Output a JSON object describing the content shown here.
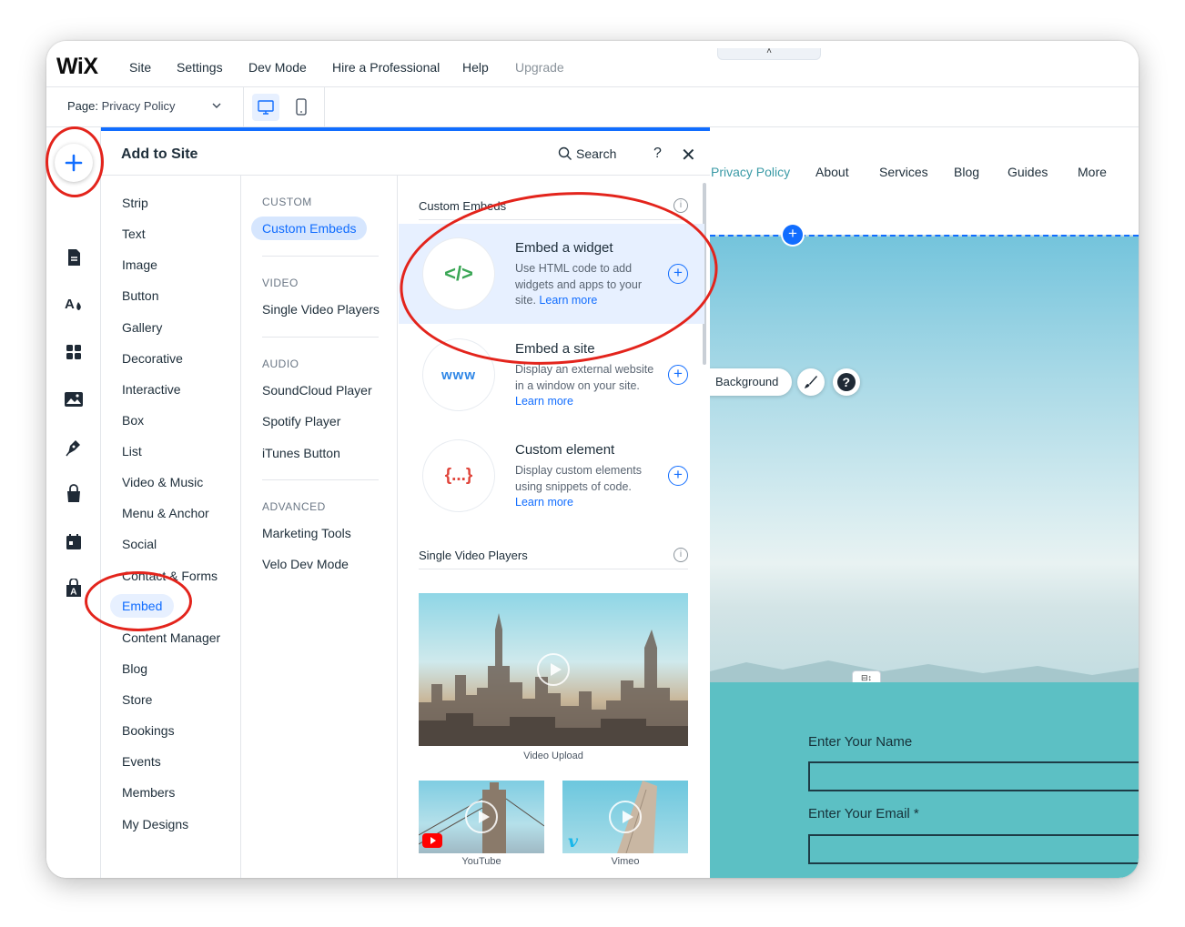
{
  "topbar": {
    "logo": "WiX",
    "menu": [
      "Site",
      "Settings",
      "Dev Mode",
      "Hire a Professional",
      "Help"
    ],
    "upgrade": "Upgrade",
    "collapse_glyph": "˄"
  },
  "pagebar": {
    "page_label": "Page:",
    "page_value": "Privacy Policy"
  },
  "panel": {
    "title": "Add to Site",
    "search_label": "Search",
    "help": "?",
    "close": "✕",
    "categories": [
      "Strip",
      "Text",
      "Image",
      "Button",
      "Gallery",
      "Decorative",
      "Interactive",
      "Box",
      "List",
      "Video & Music",
      "Menu & Anchor",
      "Social",
      "Contact & Forms",
      "Embed",
      "Content Manager",
      "Blog",
      "Store",
      "Bookings",
      "Events",
      "Members",
      "My Designs"
    ],
    "active_category": "Embed",
    "subcategories": {
      "custom_head": "CUSTOM",
      "custom_item": "Custom Embeds",
      "video_head": "VIDEO",
      "video_item": "Single Video Players",
      "audio_head": "AUDIO",
      "audio_items": [
        "SoundCloud Player",
        "Spotify Player",
        "iTunes Button"
      ],
      "advanced_head": "ADVANCED",
      "advanced_items": [
        "Marketing Tools",
        "Velo Dev Mode"
      ]
    },
    "content": {
      "section1_title": "Custom Embeds",
      "cards": [
        {
          "icon_text": "</>",
          "title": "Embed a widget",
          "desc": "Use HTML code to add widgets and apps to your site.",
          "link": "Learn more"
        },
        {
          "icon_text": "www",
          "title": "Embed a site",
          "desc": "Display an external website in a window on your site.",
          "link": "Learn more"
        },
        {
          "icon_text": "{...}",
          "title": "Custom element",
          "desc": "Display custom elements using snippets of code.",
          "link": "Learn more"
        }
      ],
      "section2_title": "Single Video Players",
      "video_captions": [
        "Video Upload",
        "YouTube",
        "Vimeo"
      ],
      "info_glyph": "i",
      "plus_glyph": "+"
    }
  },
  "canvas": {
    "nav": [
      "Privacy Policy",
      "About",
      "Services",
      "Blog",
      "Guides",
      "More"
    ],
    "background_button": "Background",
    "hero_plus": "+",
    "stretch_glyph": "⊟↕",
    "form": {
      "name_label": "Enter Your Name",
      "email_label": "Enter Your Email *"
    }
  },
  "colors": {
    "accent": "#116dff",
    "annotation_red": "#e3241c",
    "form_bg": "#5cc0c4",
    "widget_icon_green": "#3aa655",
    "element_icon_red": "#e0443a",
    "www_icon_blue": "#2e86e6"
  }
}
